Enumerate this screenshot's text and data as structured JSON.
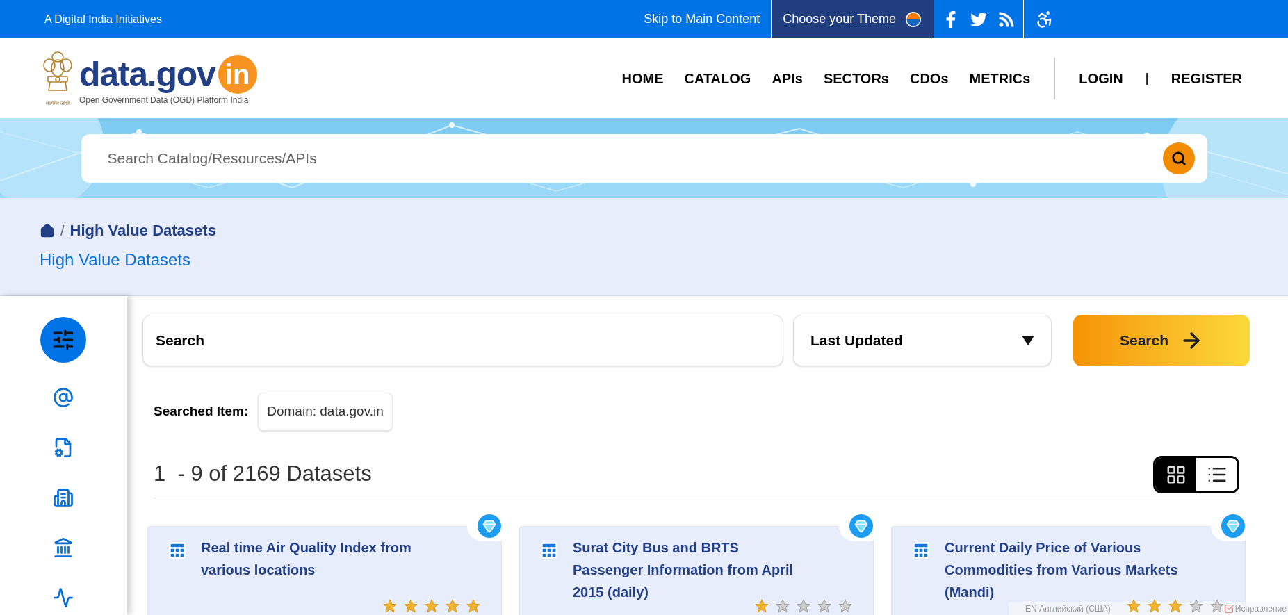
{
  "top_bar": {
    "tagline": "A Digital India Initiatives",
    "skip_link": "Skip to Main Content",
    "theme_label": "Choose your Theme"
  },
  "header": {
    "logo": {
      "brand": "data.gov",
      "badge": "in",
      "subtitle": "Open Government Data (OGD) Platform India",
      "motto": "सत्यमेव जयते"
    },
    "nav": [
      "HOME",
      "CATALOG",
      "APIs",
      "SECTORs",
      "CDOs",
      "METRICs"
    ],
    "auth": [
      {
        "kind": "link",
        "label": "LOGIN"
      },
      {
        "kind": "separator",
        "label": "|"
      },
      {
        "kind": "link",
        "label": "REGISTER"
      }
    ]
  },
  "banner": {
    "kind": "picture",
    "search_placeholder": "Search Catalog/Resources/APIs"
  },
  "breadcrumb": {
    "separator": "/",
    "items": [
      "High Value Datasets"
    ],
    "title": "High Value Datasets"
  },
  "sidebar": [
    {
      "kind": "filters",
      "selected": true
    },
    {
      "kind": "email",
      "selected": false
    },
    {
      "kind": "file-settings",
      "selected": false
    },
    {
      "kind": "office",
      "selected": false
    },
    {
      "kind": "capitol",
      "selected": false
    },
    {
      "kind": "pulse",
      "selected": false
    }
  ],
  "filters": {
    "search_placeholder": "Search",
    "sort": "Last Updated",
    "button": "Search"
  },
  "searched_item": {
    "label": "Searched Item:",
    "tag": "Domain: data.gov.in"
  },
  "results_count": "1  - 9 of 2169 Datasets",
  "view_toggle": [
    {
      "kind": "grid",
      "selected": true
    },
    {
      "kind": "list",
      "selected": false
    }
  ],
  "cards": [
    {
      "title": "Real time Air Quality Index from various locations",
      "stars": 5
    },
    {
      "title": "Surat City Bus and BRTS Passenger Information from April 2015 (daily)",
      "stars": 1
    },
    {
      "title": "Current Daily Price of Various Commodities from Various Markets (Mandi)",
      "stars": 3
    }
  ],
  "ime_bar": {
    "language": "EN Английский (США)",
    "action": "Исправление"
  }
}
